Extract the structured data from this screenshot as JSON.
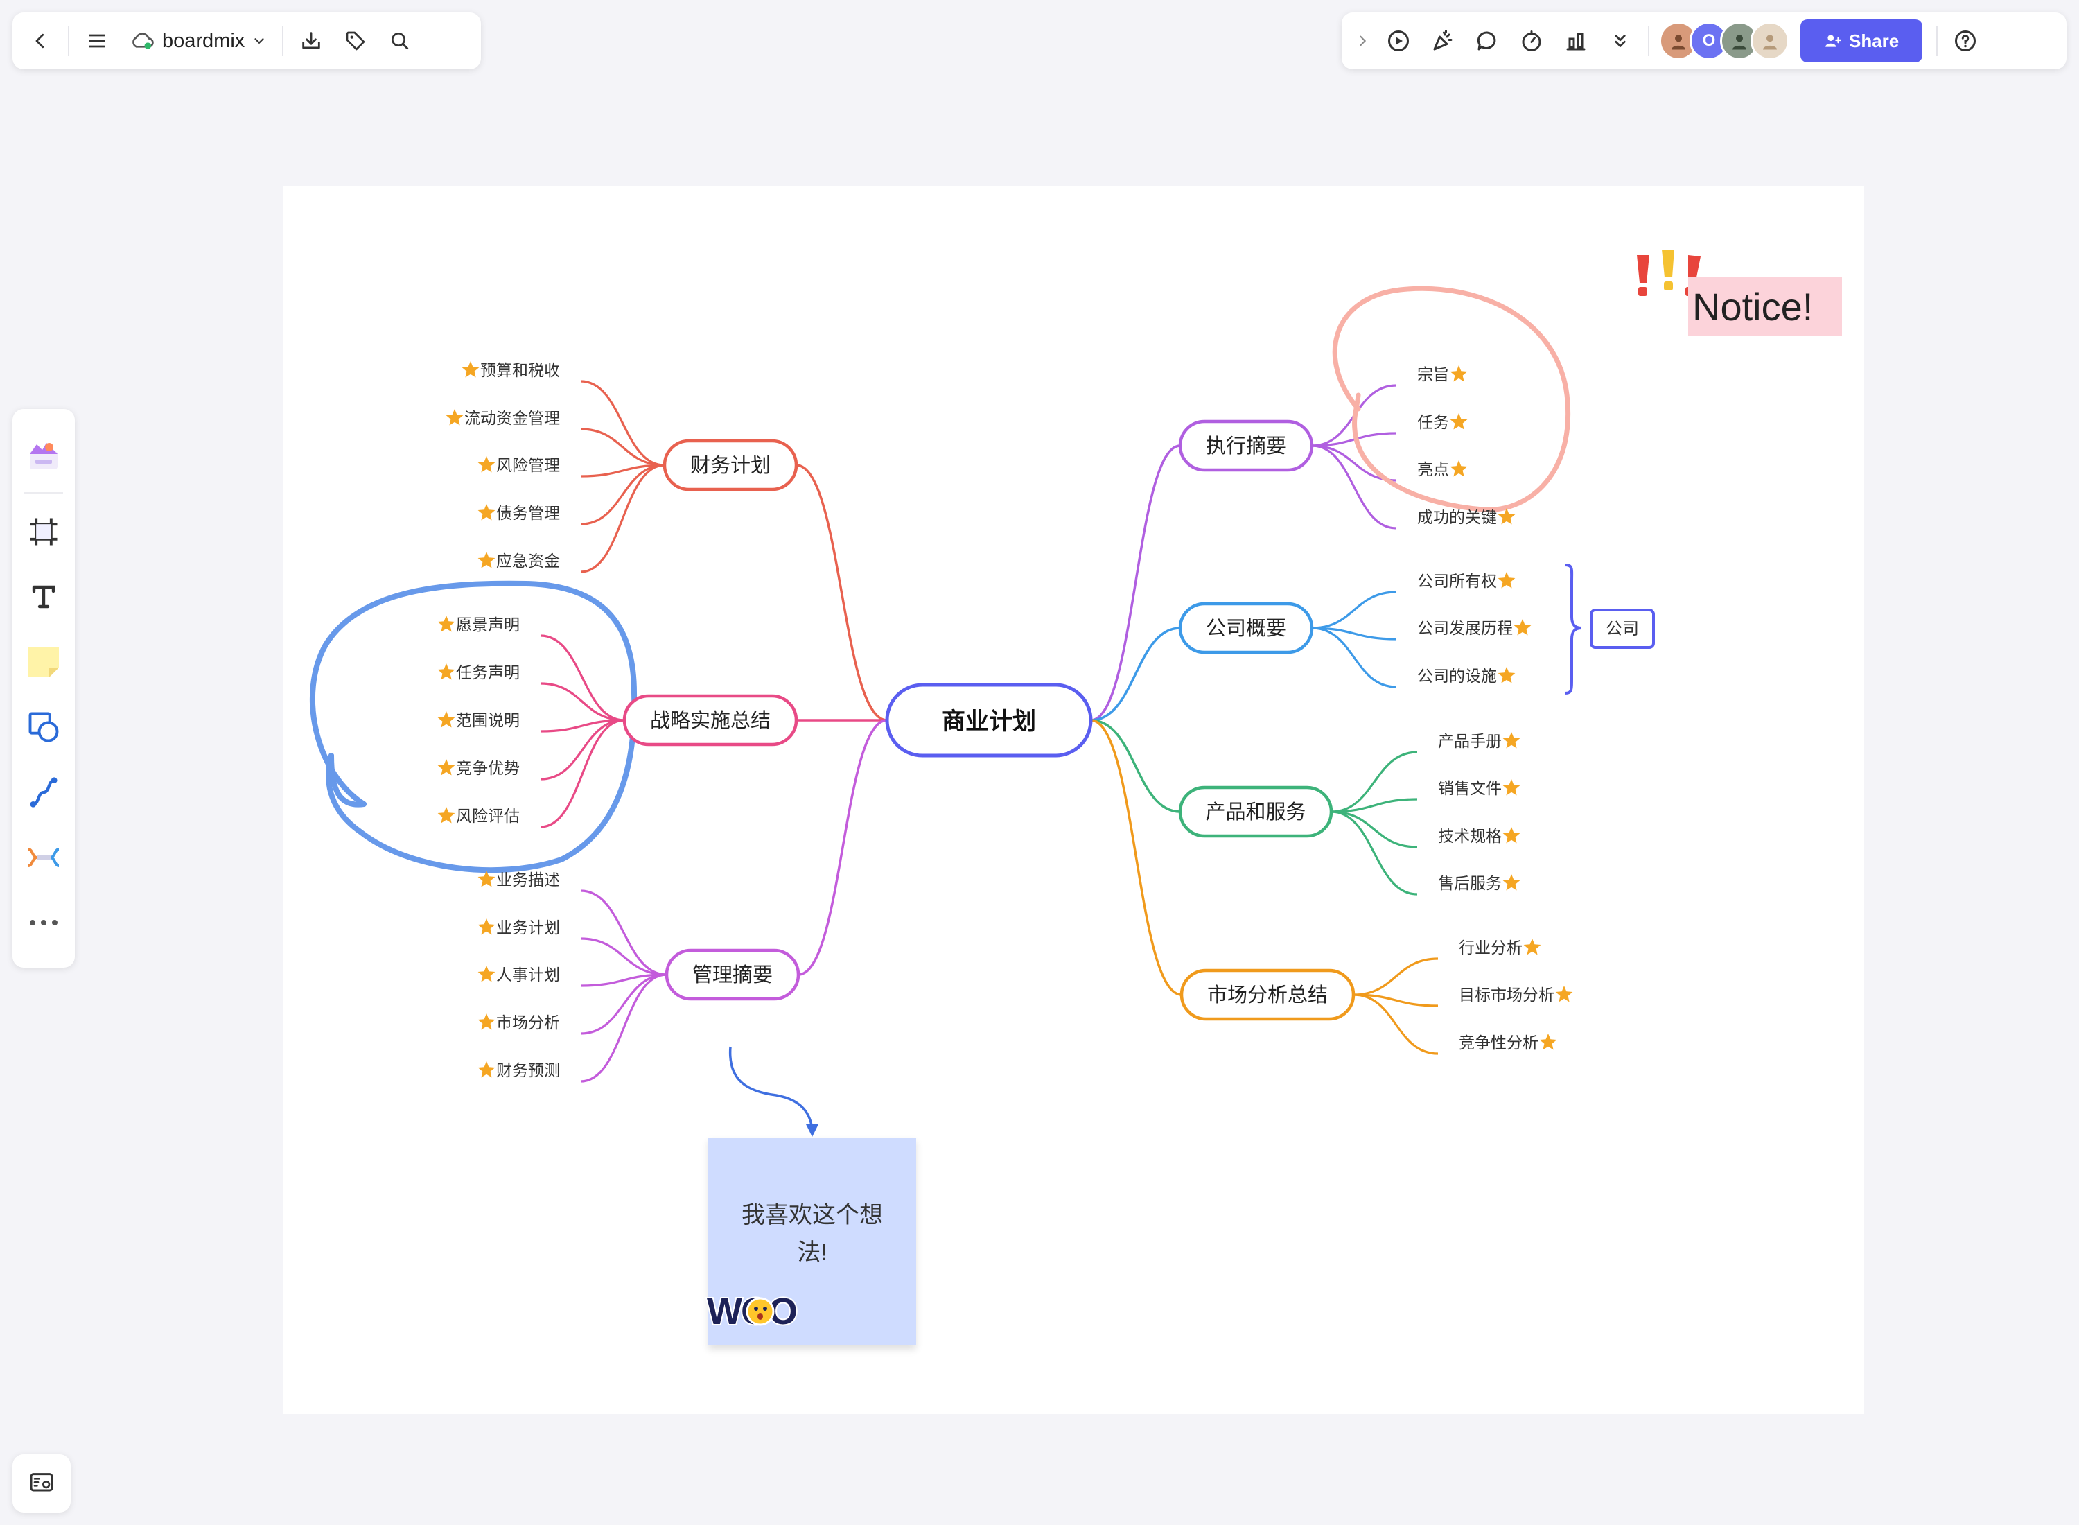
{
  "topbar": {
    "app_name": "boardmix"
  },
  "collab": {
    "avatar_initial": "O",
    "share_label": "Share"
  },
  "mindmap": {
    "root": "商业计划",
    "branches": [
      {
        "label": "财务计划",
        "color": "#e8614f",
        "items": [
          "预算和税收",
          "流动资金管理",
          "风险管理",
          "债务管理",
          "应急资金"
        ]
      },
      {
        "label": "战略实施总结",
        "color": "#e84a86",
        "items": [
          "愿景声明",
          "任务声明",
          "范围说明",
          "竞争优势",
          "风险评估"
        ]
      },
      {
        "label": "管理摘要",
        "color": "#c35cdb",
        "items": [
          "业务描述",
          "业务计划",
          "人事计划",
          "市场分析",
          "财务预测"
        ]
      },
      {
        "label": "执行摘要",
        "color": "#b05fe0",
        "items": [
          "宗旨",
          "任务",
          "亮点",
          "成功的关键"
        ]
      },
      {
        "label": "公司概要",
        "color": "#3d9ae8",
        "items": [
          "公司所有权",
          "公司发展历程",
          "公司的设施"
        ]
      },
      {
        "label": "产品和服务",
        "color": "#3db37a",
        "items": [
          "产品手册",
          "销售文件",
          "技术规格",
          "售后服务"
        ]
      },
      {
        "label": "市场分析总结",
        "color": "#f09a1c",
        "items": [
          "行业分析",
          "目标市场分析",
          "竞争性分析"
        ]
      }
    ],
    "summary_label": "公司"
  },
  "sticky_note": {
    "text": "我喜欢这个想法!",
    "sticker_text": "WOO"
  },
  "notice_text": "Notice!"
}
